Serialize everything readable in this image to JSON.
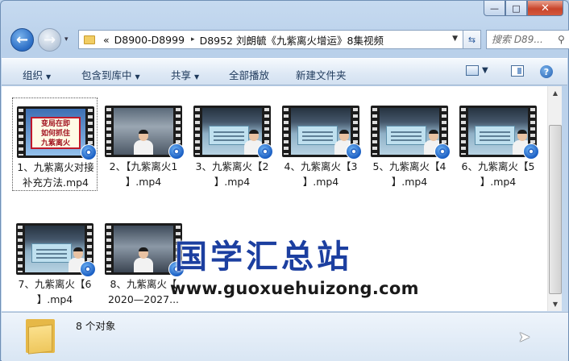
{
  "window": {
    "minimize_glyph": "—",
    "maximize_glyph": "□",
    "close_glyph": "✕"
  },
  "nav": {
    "history_glyph": "▾",
    "address": {
      "prefix": "«",
      "crumbs": [
        "D8900-D8999",
        "D8952 刘朗毓《九紫离火增运》8集视频"
      ],
      "separator": "▸"
    },
    "search_placeholder": "搜索 D89..."
  },
  "toolbar": {
    "organize": "组织",
    "include_in_library": "包含到库中",
    "share": "共享",
    "play_all": "全部播放",
    "new_folder": "新建文件夹"
  },
  "files": [
    {
      "name": "1、九紫离火对接补充方法.mp4",
      "line1": "1、九紫离火对接",
      "line2": "补充方法.mp4",
      "thumb": "title",
      "caption": [
        "变局在即",
        "如何抓住",
        "九紫离火"
      ]
    },
    {
      "name": "2、【九紫离火1】.mp4",
      "line1": "2、【九紫离火1",
      "line2": "】.mp4",
      "thumb": "speaker"
    },
    {
      "name": "3、九紫离火【2】.mp4",
      "line1": "3、九紫离火【2",
      "line2": "】.mp4",
      "thumb": "board"
    },
    {
      "name": "4、九紫离火【3】.mp4",
      "line1": "4、九紫离火【3",
      "line2": "】.mp4",
      "thumb": "board"
    },
    {
      "name": "5、九紫离火【4】.mp4",
      "line1": "5、九紫离火【4",
      "line2": "】.mp4",
      "thumb": "board"
    },
    {
      "name": "6、九紫离火【5】.mp4",
      "line1": "6、九紫离火【5",
      "line2": "】.mp4",
      "thumb": "board"
    },
    {
      "name": "7、九紫离火【6】.mp4",
      "line1": "7、九紫离火【6",
      "line2": "】.mp4",
      "thumb": "board"
    },
    {
      "name": "8、九紫离火【2020—2027...",
      "line1": "8、九紫离火【",
      "line2": "2020—2027...",
      "thumb": "speaker"
    }
  ],
  "watermark": {
    "cn": "国学汇总站",
    "url": "www.guoxuehuizong.com"
  },
  "status": {
    "item_count": "8 个对象"
  },
  "colors": {
    "accent": "#1c3fa0",
    "toolbar_text": "#1e395b",
    "close_red": "#c8442b"
  }
}
